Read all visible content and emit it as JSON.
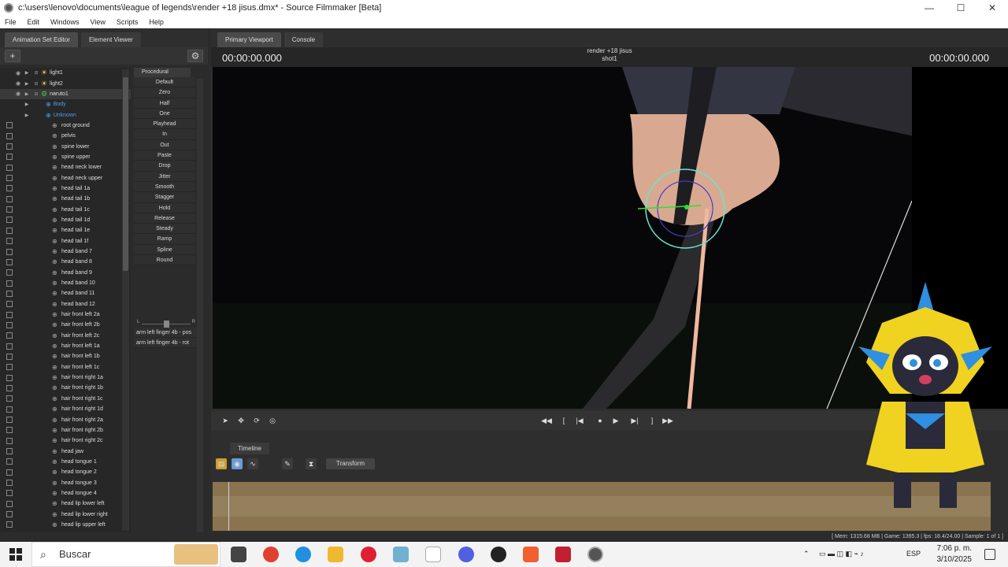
{
  "window": {
    "title": "c:\\users\\lenovo\\documents\\league of legends\\render +18 jisus.dmx* - Source Filmmaker [Beta]",
    "controls": {
      "minimize": "—",
      "maximize": "☐",
      "close": "✕"
    }
  },
  "menu": [
    "File",
    "Edit",
    "Windows",
    "View",
    "Scripts",
    "Help"
  ],
  "left_tabs": {
    "animation_set_editor": "Animation Set Editor",
    "element_viewer": "Element Viewer"
  },
  "tree": {
    "top_items": [
      {
        "label": "light1",
        "type": "light"
      },
      {
        "label": "light2",
        "type": "light"
      },
      {
        "label": "naruto1",
        "type": "model"
      },
      {
        "label": "Body",
        "type": "group"
      },
      {
        "label": "Unknown",
        "type": "group"
      }
    ],
    "bones": [
      "root ground",
      "pelvis",
      "spine lower",
      "spine upper",
      "head neck lower",
      "head neck upper",
      "head tail 1a",
      "head tail 1b",
      "head tail 1c",
      "head tail 1d",
      "head tail 1e",
      "head tail 1f",
      "head band 7",
      "head band 8",
      "head band 9",
      "head band 10",
      "head band 11",
      "head band 12",
      "hair front left 2a",
      "hair front left 2b",
      "hair front left 2c",
      "hair front left 1a",
      "hair front left 1b",
      "hair front left 1c",
      "hair front right 1a",
      "hair front right 1b",
      "hair front right 1c",
      "hair front right 1d",
      "hair front right 2a",
      "hair front right 2b",
      "hair front right 2c",
      "head jaw",
      "head tongue 1",
      "head tongue 2",
      "head tongue 3",
      "head tongue 4",
      "head lip lower left",
      "head lip lower right",
      "head lip upper left"
    ]
  },
  "procedural": {
    "header": "Procedural",
    "items": [
      "Default",
      "Zero",
      "Half",
      "One",
      "Playhead",
      "In",
      "Out",
      "Paste",
      "Drop",
      "Jitter",
      "Smooth",
      "Stagger",
      "Hold",
      "Release",
      "Steady",
      "Ramp",
      "Spline",
      "Round"
    ],
    "slider": {
      "left": "L",
      "right": "R"
    },
    "controls": [
      "arm left finger 4b - pos",
      "arm left finger 4b - rot"
    ]
  },
  "right_tabs": {
    "primary_viewport": "Primary Viewport",
    "console": "Console"
  },
  "viewport": {
    "timecode_left": "00:00:00.000",
    "timecode_right": "00:00:00.000",
    "session_name": "render +18 jisus",
    "shot_name": "shot1"
  },
  "timeline": {
    "tab": "Timeline",
    "transform_label": "Transform"
  },
  "status": "[ Mem: 1315.68 MB | Game:   1395.3 | fps:  18.4/24.00 | Sample:                  1 of 1 ]",
  "taskbar": {
    "search_placeholder": "Buscar",
    "lang": "ESP",
    "time": "7:06 p. m.",
    "date": "3/10/2025"
  },
  "colors": {
    "accent_blue": "#4aa0e6",
    "light_icon": "#e6d34a",
    "model_icon": "#4ec34a",
    "timeline": "#8a7450"
  }
}
